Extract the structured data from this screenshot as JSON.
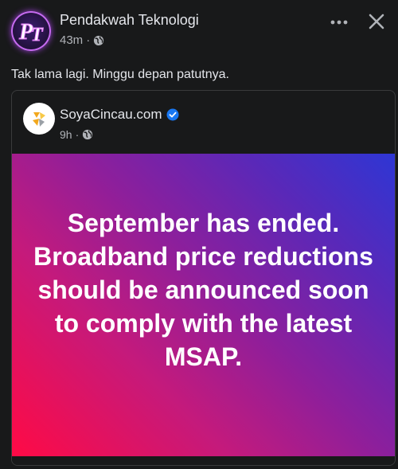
{
  "post": {
    "author": "Pendakwah Teknologi",
    "avatar_initials": "PT",
    "time": "43m",
    "separator": "·",
    "text": "Tak lama lagi. Minggu depan patutnya."
  },
  "shared": {
    "source_name": "SoyaCincau.com",
    "time": "9h",
    "separator": "·",
    "headline": "September has ended. Broadband price reductions should be announced soon to comply with the latest MSAP."
  },
  "icons": {
    "more": "more-horizontal-icon",
    "close": "close-icon",
    "privacy": "globe-icon",
    "verified": "verified-badge-icon"
  },
  "colors": {
    "background": "#18191a",
    "text_primary": "#e4e6eb",
    "text_secondary": "#b0b3b8",
    "verified_blue": "#1877f2",
    "gradient_start": "#ff0a45",
    "gradient_end": "#2e36d4"
  }
}
